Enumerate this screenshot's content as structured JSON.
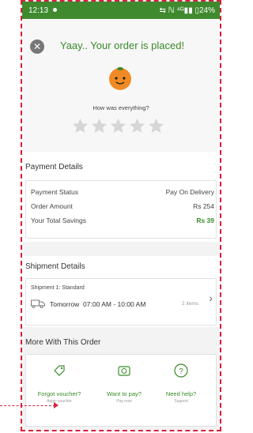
{
  "status_bar": {
    "time": "12:13",
    "right": "⇆ ℕ ⁴ᴳ▮▮ ▯24%"
  },
  "hero": {
    "title": "Yaay.. Your order is placed!",
    "question": "How was everything?",
    "rating": 0
  },
  "payment": {
    "section_title": "Payment Details",
    "rows": [
      {
        "label": "Payment Status",
        "value": "Pay On Delivery"
      },
      {
        "label": "Order Amount",
        "value": "Rs 254"
      },
      {
        "label": "Your Total Savings",
        "value": "Rs 39"
      }
    ],
    "savings_color": "#3a8a2a"
  },
  "shipment": {
    "section_title": "Shipment Details",
    "label": "Shipment 1: Standard",
    "slot": "Tomorrow  07:00 AM - 10:00 AM",
    "items": "2 items"
  },
  "more": {
    "section_title": "More With This Order",
    "actions": [
      {
        "label": "Forgot voucher?",
        "sub": "Apply voucher",
        "icon": "voucher-icon"
      },
      {
        "label": "Want to pay?",
        "sub": "Pay now",
        "icon": "rupee-pay-icon"
      },
      {
        "label": "Need help?",
        "sub": "Support",
        "icon": "help-icon"
      }
    ]
  },
  "colors": {
    "brand_green": "#3f8a2f",
    "annotation_red": "#d8203a"
  }
}
